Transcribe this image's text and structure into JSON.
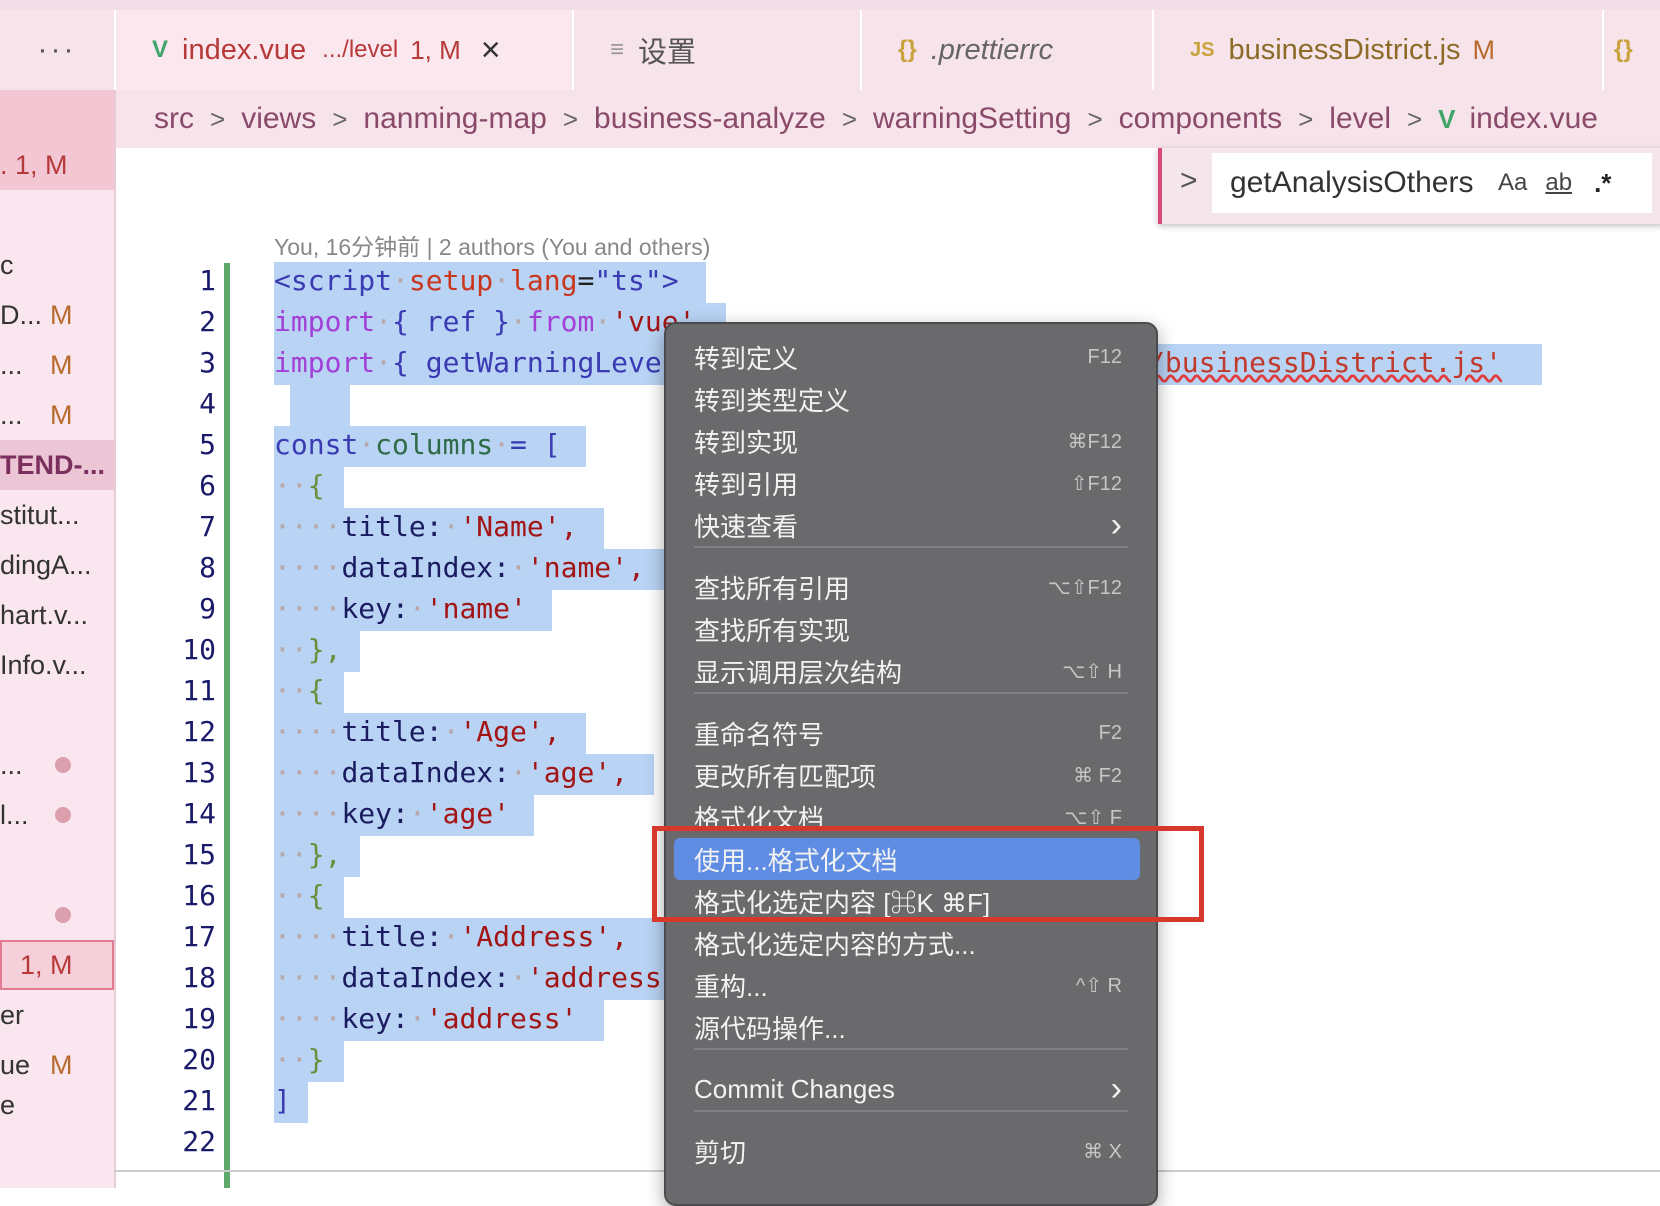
{
  "tabs": {
    "more": "···",
    "active": {
      "icon": "V",
      "name": "index.vue",
      "path": ".../level",
      "status": "1, M",
      "close": "×"
    },
    "settings": {
      "icon": "≡",
      "name": "设置"
    },
    "prettier": {
      "icon": "{}",
      "name": ".prettierrc"
    },
    "business": {
      "icon": "JS",
      "name": "businessDistrict.js",
      "status": "M"
    },
    "partial": {
      "icon": "{}"
    }
  },
  "breadcrumb": [
    "src",
    "views",
    "nanming-map",
    "business-analyze",
    "warningSetting",
    "components",
    "level",
    "index.vue"
  ],
  "breadcrumb_sep": ">",
  "find": {
    "arrow": ">",
    "value": "getAnalysisOthers",
    "opt_case": "Aa",
    "opt_word": "ab",
    "opt_regex": ".*"
  },
  "sidebar": [
    {
      "text": ". 1, M"
    },
    {
      "text": "c"
    },
    {
      "text": "D...",
      "mark": "M"
    },
    {
      "text": "...",
      "mark": "M"
    },
    {
      "text": "...",
      "mark": "M"
    },
    {
      "text": "TEND-..."
    },
    {
      "text": "stitut..."
    },
    {
      "text": "dingA..."
    },
    {
      "text": "hart.v..."
    },
    {
      "text": "Info.v..."
    },
    {
      "text": "..."
    },
    {
      "text": "l..."
    },
    {
      "text": ""
    },
    {
      "text": "1, M"
    },
    {
      "text": "er"
    },
    {
      "text": "ue",
      "mark": "M"
    },
    {
      "text": "e"
    }
  ],
  "blame": "You, 16分钟前 | 2 authors (You and others)",
  "line_numbers": [
    "1",
    "2",
    "3",
    "4",
    "5",
    "6",
    "7",
    "8",
    "9",
    "10",
    "11",
    "12",
    "13",
    "14",
    "15",
    "16",
    "17",
    "18",
    "19",
    "20",
    "21",
    "22"
  ],
  "code": {
    "l1a": "<script",
    "l1b": "setup",
    "l1c": "lang",
    "l1d": "=",
    "l1e": "\"ts\"",
    "l1f": ">",
    "l2a": "import",
    "l2b": "{ ref }",
    "l2c": "from",
    "l2d": "'vue'",
    "l3a": "import",
    "l3b": "{ getWarningLeve",
    "l3tail": "/businessDistrict.js'",
    "l5a": "const",
    "l5b": "columns",
    "l5c": "= [",
    "l7key": "title:",
    "l7val": "'Name',",
    "l8key": "dataIndex:",
    "l8val": "'name',",
    "l9key": "key:",
    "l9val": "'name'",
    "l12val": "'Age',",
    "l13val": "'age',",
    "l14val": "'age'",
    "l17val": "'Address',",
    "l18val": "'address",
    "l19val": "'address'",
    "open": "{",
    "closec": "},",
    "close": "}",
    "bracket": "]"
  },
  "menu": [
    {
      "label": "转到定义",
      "shortcut": "F12"
    },
    {
      "label": "转到类型定义",
      "shortcut": ""
    },
    {
      "label": "转到实现",
      "shortcut": "⌘F12"
    },
    {
      "label": "转到引用",
      "shortcut": "⇧F12"
    },
    {
      "label": "快速查看",
      "shortcut": "›"
    },
    {
      "label": "查找所有引用",
      "shortcut": "⌥⇧F12"
    },
    {
      "label": "查找所有实现",
      "shortcut": ""
    },
    {
      "label": "显示调用层次结构",
      "shortcut": "⌥⇧ H"
    },
    {
      "label": "重命名符号",
      "shortcut": "F2"
    },
    {
      "label": "更改所有匹配项",
      "shortcut": "⌘ F2"
    },
    {
      "label": "格式化文档",
      "shortcut": "⌥⇧ F"
    },
    {
      "label": "使用...格式化文档",
      "shortcut": ""
    },
    {
      "label": "格式化选定内容 [⌘K ⌘F]",
      "shortcut": ""
    },
    {
      "label": "格式化选定内容的方式...",
      "shortcut": ""
    },
    {
      "label": "重构...",
      "shortcut": "^⇧ R"
    },
    {
      "label": "源代码操作...",
      "shortcut": ""
    },
    {
      "label": "Commit Changes",
      "shortcut": "›"
    },
    {
      "label": "剪切",
      "shortcut": "⌘ X"
    }
  ],
  "colors": {
    "highlight": "#5f8de3",
    "annotation": "#d6382b",
    "selection": "#b8d3f4"
  }
}
